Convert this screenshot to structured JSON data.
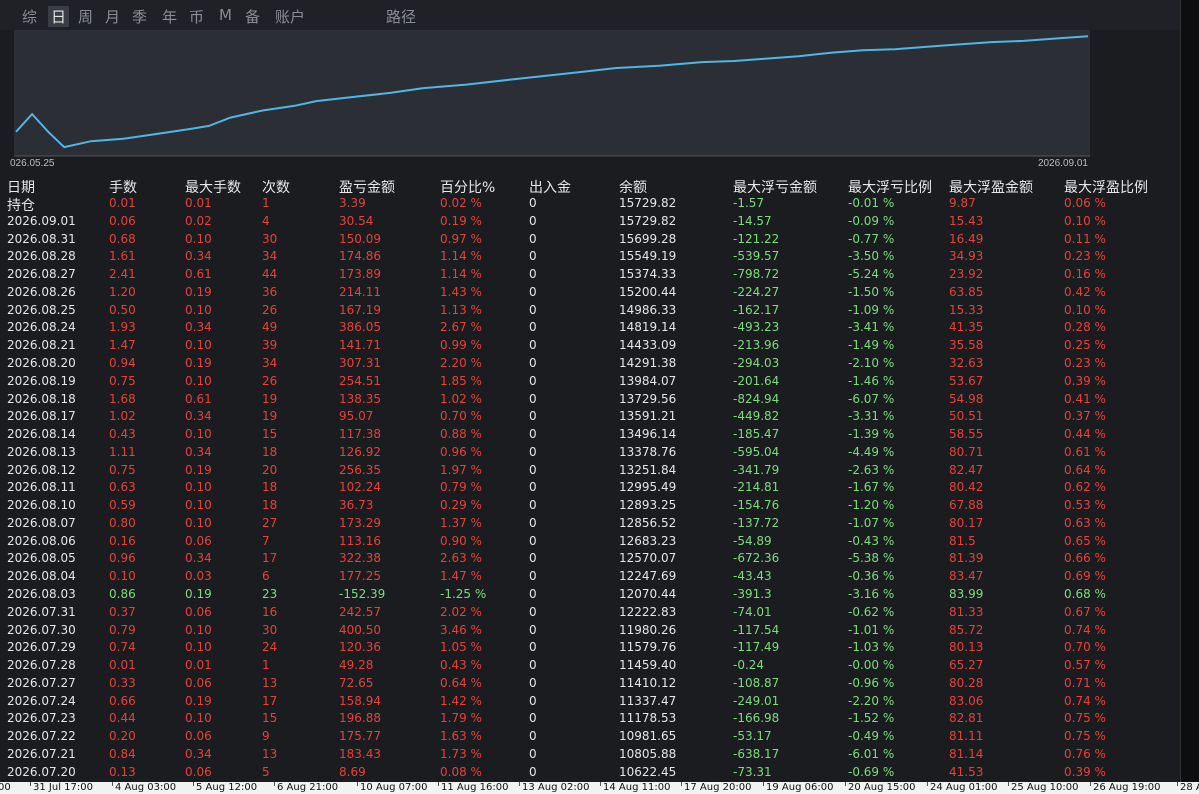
{
  "tabs": [
    "综",
    "日",
    "周",
    "月",
    "季",
    "年",
    "币",
    "M",
    "备",
    "账户",
    "路径"
  ],
  "active_tab": "日",
  "chart": {
    "start_label": "026.05.25",
    "end_label": "2026.09.01",
    "line_color": "#4fb6e6",
    "points": [
      [
        0.0,
        0.82
      ],
      [
        0.015,
        0.67
      ],
      [
        0.03,
        0.82
      ],
      [
        0.045,
        0.95
      ],
      [
        0.07,
        0.9
      ],
      [
        0.1,
        0.88
      ],
      [
        0.13,
        0.84
      ],
      [
        0.16,
        0.8
      ],
      [
        0.18,
        0.77
      ],
      [
        0.2,
        0.7
      ],
      [
        0.23,
        0.64
      ],
      [
        0.26,
        0.6
      ],
      [
        0.28,
        0.56
      ],
      [
        0.31,
        0.53
      ],
      [
        0.35,
        0.49
      ],
      [
        0.38,
        0.45
      ],
      [
        0.42,
        0.42
      ],
      [
        0.46,
        0.38
      ],
      [
        0.5,
        0.34
      ],
      [
        0.53,
        0.31
      ],
      [
        0.56,
        0.28
      ],
      [
        0.6,
        0.26
      ],
      [
        0.64,
        0.23
      ],
      [
        0.67,
        0.22
      ],
      [
        0.7,
        0.2
      ],
      [
        0.73,
        0.18
      ],
      [
        0.76,
        0.15
      ],
      [
        0.79,
        0.13
      ],
      [
        0.82,
        0.12
      ],
      [
        0.85,
        0.1
      ],
      [
        0.88,
        0.08
      ],
      [
        0.91,
        0.06
      ],
      [
        0.94,
        0.05
      ],
      [
        0.97,
        0.03
      ],
      [
        1.0,
        0.01
      ]
    ]
  },
  "table": {
    "headers": [
      "日期",
      "手数",
      "最大手数",
      "次数",
      "盈亏金额",
      "百分比%",
      "出入金",
      "余额",
      "最大浮亏金额",
      "最大浮亏比例",
      "最大浮盈金额",
      "最大浮盈比例"
    ],
    "rows": [
      [
        "持仓",
        "0.01",
        "0.01",
        "1",
        "3.39",
        "0.02 %",
        "0",
        "15729.82",
        "-1.57",
        "-0.01 %",
        "9.87",
        "0.06 %"
      ],
      [
        "2026.09.01",
        "0.06",
        "0.02",
        "4",
        "30.54",
        "0.19 %",
        "0",
        "15729.82",
        "-14.57",
        "-0.09 %",
        "15.43",
        "0.10 %"
      ],
      [
        "2026.08.31",
        "0.68",
        "0.10",
        "30",
        "150.09",
        "0.97 %",
        "0",
        "15699.28",
        "-121.22",
        "-0.77 %",
        "16.49",
        "0.11 %"
      ],
      [
        "2026.08.28",
        "1.61",
        "0.34",
        "34",
        "174.86",
        "1.14 %",
        "0",
        "15549.19",
        "-539.57",
        "-3.50 %",
        "34.93",
        "0.23 %"
      ],
      [
        "2026.08.27",
        "2.41",
        "0.61",
        "44",
        "173.89",
        "1.14 %",
        "0",
        "15374.33",
        "-798.72",
        "-5.24 %",
        "23.92",
        "0.16 %"
      ],
      [
        "2026.08.26",
        "1.20",
        "0.19",
        "36",
        "214.11",
        "1.43 %",
        "0",
        "15200.44",
        "-224.27",
        "-1.50 %",
        "63.85",
        "0.42 %"
      ],
      [
        "2026.08.25",
        "0.50",
        "0.10",
        "26",
        "167.19",
        "1.13 %",
        "0",
        "14986.33",
        "-162.17",
        "-1.09 %",
        "15.33",
        "0.10 %"
      ],
      [
        "2026.08.24",
        "1.93",
        "0.34",
        "49",
        "386.05",
        "2.67 %",
        "0",
        "14819.14",
        "-493.23",
        "-3.41 %",
        "41.35",
        "0.28 %"
      ],
      [
        "2026.08.21",
        "1.47",
        "0.10",
        "39",
        "141.71",
        "0.99 %",
        "0",
        "14433.09",
        "-213.96",
        "-1.49 %",
        "35.58",
        "0.25 %"
      ],
      [
        "2026.08.20",
        "0.94",
        "0.19",
        "34",
        "307.31",
        "2.20 %",
        "0",
        "14291.38",
        "-294.03",
        "-2.10 %",
        "32.63",
        "0.23 %"
      ],
      [
        "2026.08.19",
        "0.75",
        "0.10",
        "26",
        "254.51",
        "1.85 %",
        "0",
        "13984.07",
        "-201.64",
        "-1.46 %",
        "53.67",
        "0.39 %"
      ],
      [
        "2026.08.18",
        "1.68",
        "0.61",
        "19",
        "138.35",
        "1.02 %",
        "0",
        "13729.56",
        "-824.94",
        "-6.07 %",
        "54.98",
        "0.41 %"
      ],
      [
        "2026.08.17",
        "1.02",
        "0.34",
        "19",
        "95.07",
        "0.70 %",
        "0",
        "13591.21",
        "-449.82",
        "-3.31 %",
        "50.51",
        "0.37 %"
      ],
      [
        "2026.08.14",
        "0.43",
        "0.10",
        "15",
        "117.38",
        "0.88 %",
        "0",
        "13496.14",
        "-185.47",
        "-1.39 %",
        "58.55",
        "0.44 %"
      ],
      [
        "2026.08.13",
        "1.11",
        "0.34",
        "18",
        "126.92",
        "0.96 %",
        "0",
        "13378.76",
        "-595.04",
        "-4.49 %",
        "80.71",
        "0.61 %"
      ],
      [
        "2026.08.12",
        "0.75",
        "0.19",
        "20",
        "256.35",
        "1.97 %",
        "0",
        "13251.84",
        "-341.79",
        "-2.63 %",
        "82.47",
        "0.64 %"
      ],
      [
        "2026.08.11",
        "0.63",
        "0.10",
        "18",
        "102.24",
        "0.79 %",
        "0",
        "12995.49",
        "-214.81",
        "-1.67 %",
        "80.42",
        "0.62 %"
      ],
      [
        "2026.08.10",
        "0.59",
        "0.10",
        "18",
        "36.73",
        "0.29 %",
        "0",
        "12893.25",
        "-154.76",
        "-1.20 %",
        "67.88",
        "0.53 %"
      ],
      [
        "2026.08.07",
        "0.80",
        "0.10",
        "27",
        "173.29",
        "1.37 %",
        "0",
        "12856.52",
        "-137.72",
        "-1.07 %",
        "80.17",
        "0.63 %"
      ],
      [
        "2026.08.06",
        "0.16",
        "0.06",
        "7",
        "113.16",
        "0.90 %",
        "0",
        "12683.23",
        "-54.89",
        "-0.43 %",
        "81.5",
        "0.65 %"
      ],
      [
        "2026.08.05",
        "0.96",
        "0.34",
        "17",
        "322.38",
        "2.63 %",
        "0",
        "12570.07",
        "-672.36",
        "-5.38 %",
        "81.39",
        "0.66 %"
      ],
      [
        "2026.08.04",
        "0.10",
        "0.03",
        "6",
        "177.25",
        "1.47 %",
        "0",
        "12247.69",
        "-43.43",
        "-0.36 %",
        "83.47",
        "0.69 %"
      ],
      [
        "2026.08.03",
        "0.86",
        "0.19",
        "23",
        "-152.39",
        "-1.25 %",
        "0",
        "12070.44",
        "-391.3",
        "-3.16 %",
        "83.99",
        "0.68 %"
      ],
      [
        "2026.07.31",
        "0.37",
        "0.06",
        "16",
        "242.57",
        "2.02 %",
        "0",
        "12222.83",
        "-74.01",
        "-0.62 %",
        "81.33",
        "0.67 %"
      ],
      [
        "2026.07.30",
        "0.79",
        "0.10",
        "30",
        "400.50",
        "3.46 %",
        "0",
        "11980.26",
        "-117.54",
        "-1.01 %",
        "85.72",
        "0.74 %"
      ],
      [
        "2026.07.29",
        "0.74",
        "0.10",
        "24",
        "120.36",
        "1.05 %",
        "0",
        "11579.76",
        "-117.49",
        "-1.03 %",
        "80.13",
        "0.70 %"
      ],
      [
        "2026.07.28",
        "0.01",
        "0.01",
        "1",
        "49.28",
        "0.43 %",
        "0",
        "11459.40",
        "-0.24",
        "-0.00 %",
        "65.27",
        "0.57 %"
      ],
      [
        "2026.07.27",
        "0.33",
        "0.06",
        "13",
        "72.65",
        "0.64 %",
        "0",
        "11410.12",
        "-108.87",
        "-0.96 %",
        "80.28",
        "0.71 %"
      ],
      [
        "2026.07.24",
        "0.66",
        "0.19",
        "17",
        "158.94",
        "1.42 %",
        "0",
        "11337.47",
        "-249.01",
        "-2.20 %",
        "83.06",
        "0.74 %"
      ],
      [
        "2026.07.23",
        "0.44",
        "0.10",
        "15",
        "196.88",
        "1.79 %",
        "0",
        "11178.53",
        "-166.98",
        "-1.52 %",
        "82.81",
        "0.75 %"
      ],
      [
        "2026.07.22",
        "0.20",
        "0.06",
        "9",
        "175.77",
        "1.63 %",
        "0",
        "10981.65",
        "-53.17",
        "-0.49 %",
        "81.11",
        "0.75 %"
      ],
      [
        "2026.07.21",
        "0.84",
        "0.34",
        "13",
        "183.43",
        "1.73 %",
        "0",
        "10805.88",
        "-638.17",
        "-6.01 %",
        "81.14",
        "0.76 %"
      ],
      [
        "2026.07.20",
        "0.13",
        "0.06",
        "5",
        "8.69",
        "0.08 %",
        "0",
        "10622.45",
        "-73.31",
        "-0.69 %",
        "41.53",
        "0.39 %"
      ]
    ]
  },
  "timeline": [
    "00",
    "31 Jul 17:00",
    "4 Aug 03:00",
    "5 Aug 12:00",
    "6 Aug 21:00",
    "10 Aug 07:00",
    "11 Aug 16:00",
    "13 Aug 02:00",
    "14 Aug 11:00",
    "17 Aug 20:00",
    "19 Aug 06:00",
    "20 Aug 15:00",
    "24 Aug 01:00",
    "25 Aug 10:00",
    "26 Aug 19:00",
    "28 A"
  ],
  "colors": {
    "positive": "#e8413c",
    "negative": "#7ddc7d",
    "neutral": "#e6e6e6",
    "background": "#1a1c20"
  }
}
